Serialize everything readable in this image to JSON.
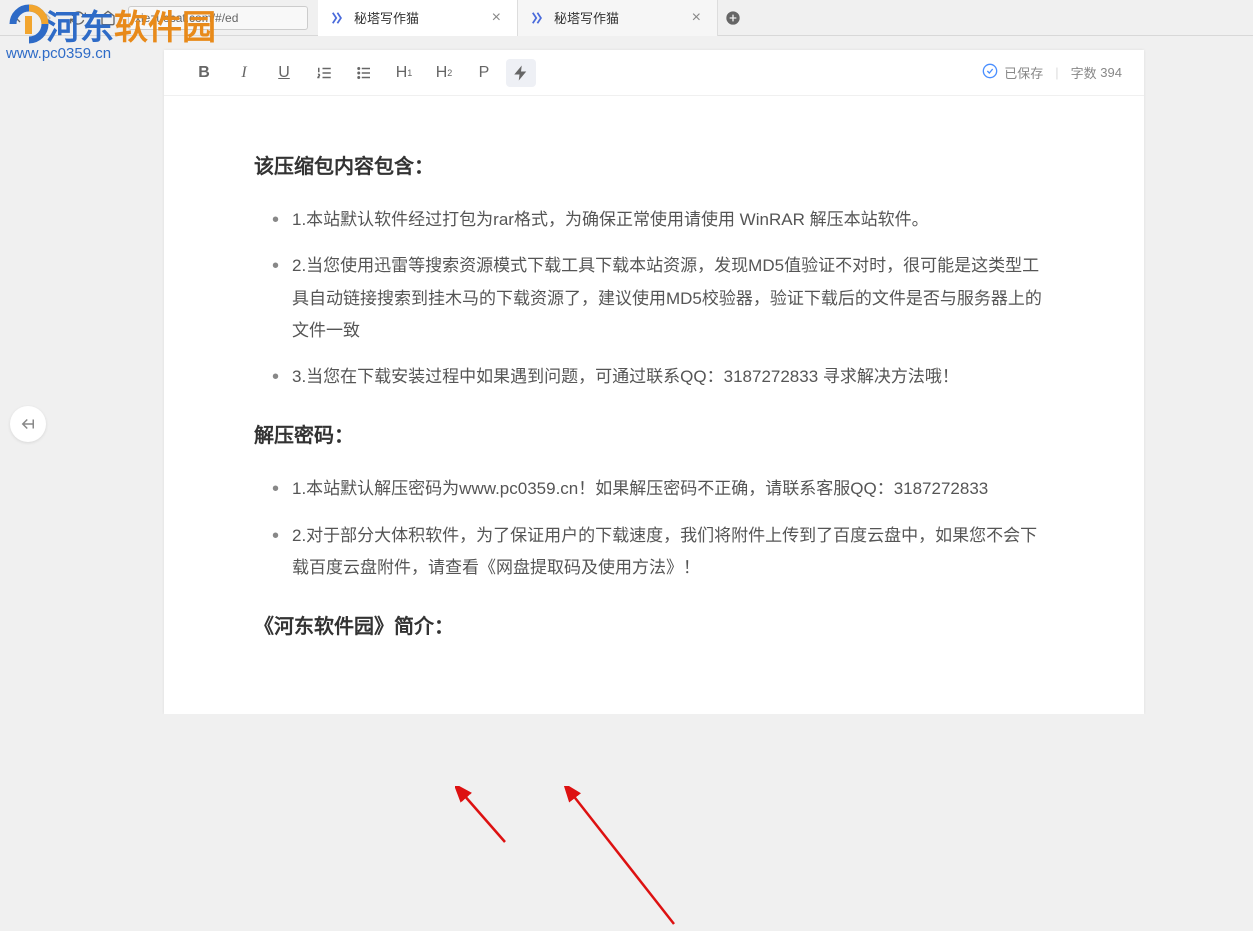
{
  "browser": {
    "url": "xiezuocat.com/#/ed",
    "tabs": [
      {
        "title": "秘塔写作猫"
      },
      {
        "title": "秘塔写作猫"
      }
    ]
  },
  "toolbar": {
    "bold": "B",
    "italic": "I",
    "underline": "U",
    "h1": "H",
    "h1_sub": "1",
    "h2": "H",
    "h2_sub": "2",
    "p": "P"
  },
  "status": {
    "saved": "已保存",
    "word_count_label": "字数",
    "word_count": "394"
  },
  "content": {
    "h1": "该压缩包内容包含：",
    "list1": [
      "1.本站默认软件经过打包为rar格式，为确保正常使用请使用 WinRAR 解压本站软件。",
      "2.当您使用迅雷等搜索资源模式下载工具下载本站资源，发现MD5值验证不对时，很可能是这类型工具自动链接搜索到挂木马的下载资源了，建议使用MD5校验器，验证下载后的文件是否与服务器上的文件一致",
      "3.当您在下载安装过程中如果遇到问题，可通过联系QQ：3187272833 寻求解决方法哦！"
    ],
    "h2": "解压密码：",
    "list2": [
      "1.本站默认解压密码为www.pc0359.cn！如果解压密码不正确，请联系客服QQ：3187272833",
      "2.对于部分大体积软件，为了保证用户的下载速度，我们将附件上传到了百度云盘中，如果您不会下载百度云盘附件，请查看《网盘提取码及使用方法》！"
    ],
    "h3": "《河东软件园》简介："
  },
  "watermark": {
    "text1": "河东",
    "text2": "软件园",
    "url": "www.pc0359.cn"
  }
}
